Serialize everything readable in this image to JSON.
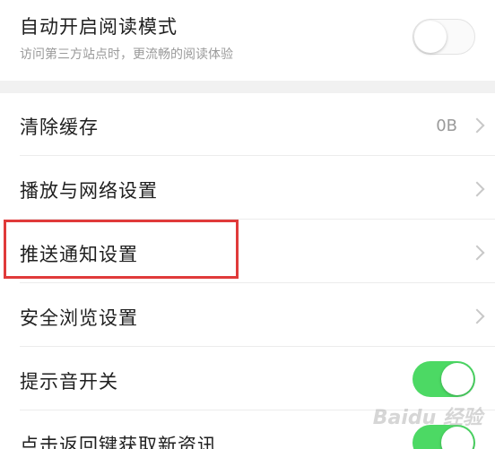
{
  "reading_mode": {
    "title": "自动开启阅读模式",
    "subtitle": "访问第三方站点时，更流畅的阅读体验",
    "enabled": false
  },
  "items": [
    {
      "label": "清除缓存",
      "value": "0B"
    },
    {
      "label": "播放与网络设置"
    },
    {
      "label": "推送通知设置"
    },
    {
      "label": "安全浏览设置"
    }
  ],
  "sound_switch": {
    "label": "提示音开关",
    "enabled": true
  },
  "back_refresh": {
    "label": "点击返回键获取新资讯",
    "enabled": true
  },
  "colors": {
    "toggle_on": "#4cd964",
    "highlight": "#e03a3a"
  },
  "watermark": "Baidu 经验"
}
